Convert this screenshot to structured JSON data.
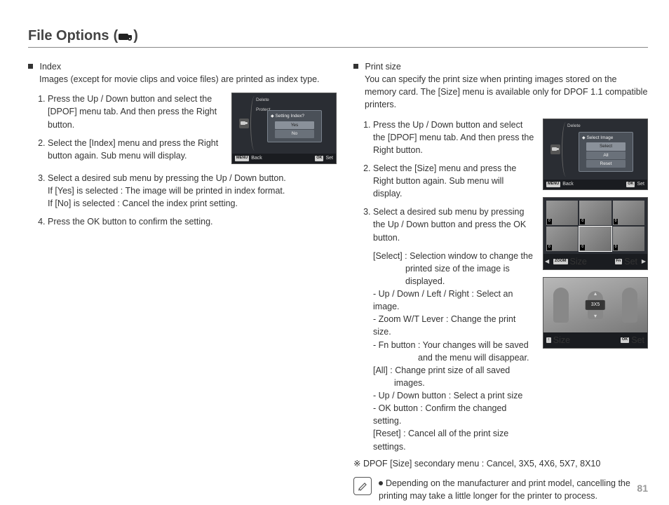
{
  "title": "File Options",
  "page_number": "81",
  "left": {
    "heading": "Index",
    "intro": "Images (except for movie clips and voice files) are printed as index type.",
    "steps": [
      "Press the Up / Down button and select the [DPOF] menu tab. And then press the Right button.",
      "Select the [Index] menu and press the Right button again. Sub menu will display.",
      "Select a desired sub menu by pressing the Up / Down button.\nIf [Yes] is selected : The image will be printed in index format.\nIf [No] is selected   : Cancel the index print setting.",
      "Press the OK button to confirm the setting."
    ],
    "screen": {
      "menu1": "Delete",
      "menu2": "Protect",
      "popup_title": "Setting Index?",
      "opt1": "Yes",
      "opt2": "No",
      "footer_back": "Back",
      "footer_set": "Set",
      "key_menu": "MENU",
      "key_ok": "OK"
    }
  },
  "right": {
    "heading": "Print size",
    "intro": "You can specify the print size when printing images stored on the memory card. The [Size] menu is available only for DPOF 1.1 compatible printers.",
    "steps": [
      "Press the Up / Down button and select the [DPOF] menu tab. And then press the Right button.",
      "Select the [Size] menu and press the Right button again. Sub menu will display.",
      "Select a desired sub menu by pressing the Up / Down button and press the OK button."
    ],
    "sub": {
      "select_label": "[Select] : Selection window to change the printed size of the image is displayed.",
      "b1": "- Up / Down / Left / Right : Select an image.",
      "b2": "- Zoom W/T Lever : Change the print size.",
      "b3": "- Fn button : Your changes will be saved and the menu will disappear.",
      "all_label": "[All] : Change print size of all saved images.",
      "b4": "- Up / Down button : Select a print size",
      "b5": "- OK button : Confirm the changed setting.",
      "reset_label": "[Reset] : Cancel all of the print size settings."
    },
    "dpof_note": "※ DPOF [Size] secondary menu : Cancel, 3X5, 4X6, 5X7, 8X10",
    "tip": "Depending on the manufacturer and print model, cancelling the printing may take a little longer for the printer to process.",
    "screen1": {
      "menu1": "Delete",
      "popup_title": "Select Image",
      "opt1": "Select",
      "opt2": "All",
      "opt3": "Reset",
      "footer_back": "Back",
      "footer_set": "Set",
      "key_menu": "MENU",
      "key_ok": "OK"
    },
    "screen2": {
      "footer_size": "Size",
      "footer_set": "Set",
      "key_zoom": "ZOOM",
      "key_fn": "Fn"
    },
    "screen3": {
      "overlay": "3X5",
      "footer_size": "Size",
      "footer_set": "Set",
      "key_updown": "↕",
      "key_ok": "OK"
    }
  }
}
